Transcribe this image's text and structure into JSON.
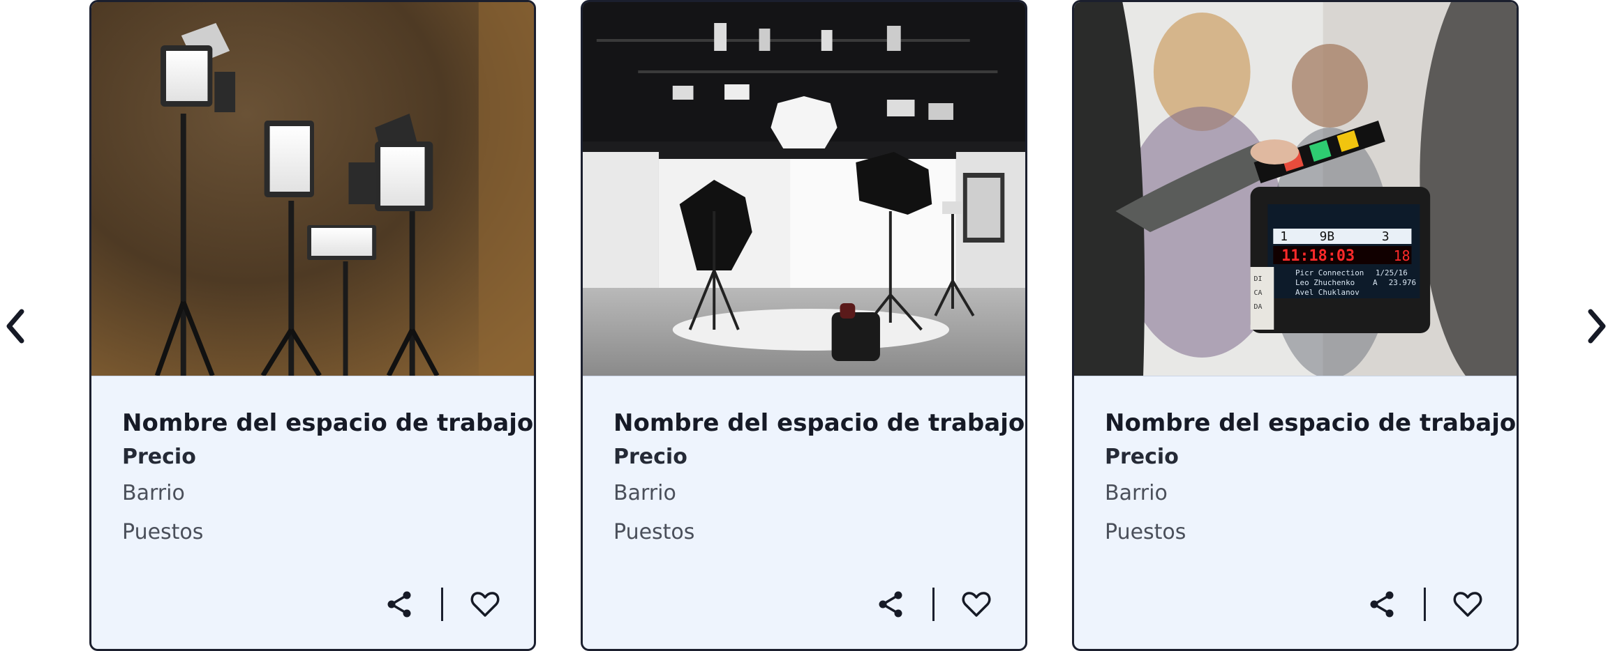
{
  "carousel": {
    "prev_icon": "chevron-left-icon",
    "next_icon": "chevron-right-icon",
    "cards": [
      {
        "image": "studio-led-lights-photo",
        "title": "Nombre del espacio de trabajo",
        "price": "Precio",
        "neighborhood": "Barrio",
        "seats": "Puestos",
        "share_icon": "share-icon",
        "favorite_icon": "heart-icon"
      },
      {
        "image": "photo-studio-umbrellas-photo",
        "title": "Nombre del espacio de trabajo",
        "price": "Precio",
        "neighborhood": "Barrio",
        "seats": "Puestos",
        "share_icon": "share-icon",
        "favorite_icon": "heart-icon"
      },
      {
        "image": "film-clapperboard-photo",
        "title": "Nombre del espacio de trabajo",
        "price": "Precio",
        "neighborhood": "Barrio",
        "seats": "Puestos",
        "share_icon": "share-icon",
        "favorite_icon": "heart-icon",
        "clapper_text": [
          "1",
          "9B",
          "3",
          "11:18:03",
          "18",
          "Picr Connection",
          "1/25/16",
          "Leo Zhuchenko",
          "A",
          "23.976",
          "Avel Chuklanov",
          "DI",
          "CA",
          "DA"
        ]
      }
    ]
  },
  "colors": {
    "card_background": "#eef4fd",
    "card_border": "#1b1f2e",
    "text_primary": "#161a26",
    "text_secondary": "#4a4f5a"
  }
}
